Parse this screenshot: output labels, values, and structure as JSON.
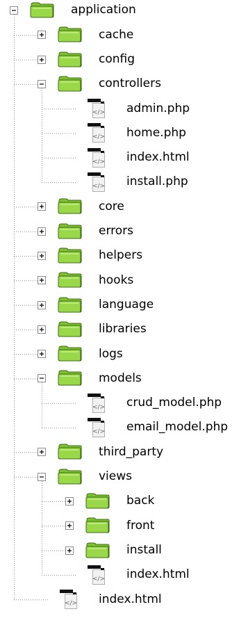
{
  "colors": {
    "connector": "#8c8c8c",
    "expander_border": "#8c8c8c",
    "expander_sign": "#000000",
    "folder_body": "#9ad84a",
    "folder_tab": "#7ec232",
    "folder_outline": "#3d6b12",
    "file_page": "#f2f2f2",
    "file_bar": "#111111",
    "file_symbol": "#6a6a6a"
  },
  "tree": [
    {
      "label": "application",
      "type": "folder",
      "expander": "minus",
      "depth": 0
    },
    {
      "label": "cache",
      "type": "folder",
      "expander": "plus",
      "depth": 1
    },
    {
      "label": "config",
      "type": "folder",
      "expander": "plus",
      "depth": 1
    },
    {
      "label": "controllers",
      "type": "folder",
      "expander": "minus",
      "depth": 1
    },
    {
      "label": "admin.php",
      "type": "file",
      "expander": "none",
      "depth": 2
    },
    {
      "label": "home.php",
      "type": "file",
      "expander": "none",
      "depth": 2
    },
    {
      "label": "index.html",
      "type": "file",
      "expander": "none",
      "depth": 2
    },
    {
      "label": "install.php",
      "type": "file",
      "expander": "none",
      "depth": 2
    },
    {
      "label": "core",
      "type": "folder",
      "expander": "plus",
      "depth": 1
    },
    {
      "label": "errors",
      "type": "folder",
      "expander": "plus",
      "depth": 1
    },
    {
      "label": "helpers",
      "type": "folder",
      "expander": "plus",
      "depth": 1
    },
    {
      "label": "hooks",
      "type": "folder",
      "expander": "plus",
      "depth": 1
    },
    {
      "label": "language",
      "type": "folder",
      "expander": "plus",
      "depth": 1
    },
    {
      "label": "libraries",
      "type": "folder",
      "expander": "plus",
      "depth": 1
    },
    {
      "label": "logs",
      "type": "folder",
      "expander": "plus",
      "depth": 1
    },
    {
      "label": "models",
      "type": "folder",
      "expander": "minus",
      "depth": 1
    },
    {
      "label": "crud_model.php",
      "type": "file",
      "expander": "none",
      "depth": 2
    },
    {
      "label": "email_model.php",
      "type": "file",
      "expander": "none",
      "depth": 2
    },
    {
      "label": "third_party",
      "type": "folder",
      "expander": "plus",
      "depth": 1
    },
    {
      "label": "views",
      "type": "folder",
      "expander": "minus",
      "depth": 1
    },
    {
      "label": "back",
      "type": "folder",
      "expander": "plus",
      "depth": 2
    },
    {
      "label": "front",
      "type": "folder",
      "expander": "plus",
      "depth": 2
    },
    {
      "label": "install",
      "type": "folder",
      "expander": "plus",
      "depth": 2
    },
    {
      "label": "index.html",
      "type": "file",
      "expander": "none",
      "depth": 2
    },
    {
      "label": "index.html",
      "type": "file",
      "expander": "none",
      "depth": 1
    }
  ]
}
